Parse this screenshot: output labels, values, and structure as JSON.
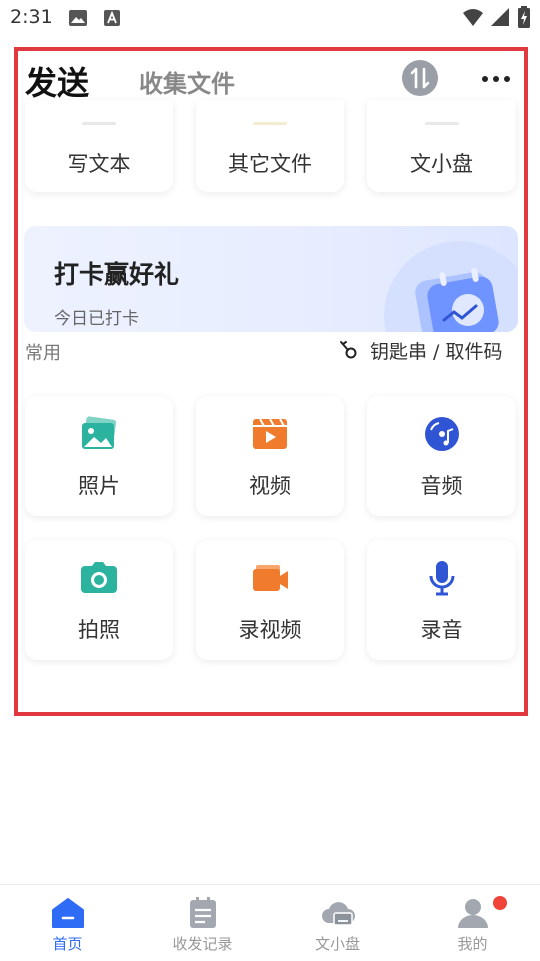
{
  "status_bar": {
    "time": "2:31"
  },
  "header": {
    "tab_send": "发送",
    "tab_collect": "收集文件"
  },
  "top_row": [
    "写文本",
    "其它文件",
    "文小盘"
  ],
  "banner": {
    "title": "打卡赢好礼",
    "subtitle": "今日已打卡"
  },
  "common": {
    "label": "常用",
    "keychain_link": "钥匙串 / 取件码"
  },
  "grid": [
    {
      "label": "照片",
      "icon": "photo-icon"
    },
    {
      "label": "视频",
      "icon": "video-icon"
    },
    {
      "label": "音频",
      "icon": "audio-icon"
    },
    {
      "label": "拍照",
      "icon": "camera-icon"
    },
    {
      "label": "录视频",
      "icon": "video-record-icon"
    },
    {
      "label": "录音",
      "icon": "microphone-icon"
    }
  ],
  "bottom_nav": [
    {
      "label": "首页",
      "icon": "home-icon",
      "active": true
    },
    {
      "label": "收发记录",
      "icon": "records-icon",
      "active": false
    },
    {
      "label": "文小盘",
      "icon": "cloud-drive-icon",
      "active": false
    },
    {
      "label": "我的",
      "icon": "profile-icon",
      "active": false,
      "badge": true
    }
  ],
  "colors": {
    "accent": "#2f6cf5",
    "teal_icon": "#2bb3a0",
    "orange_icon": "#f07b2c",
    "blue_icon": "#2f55d4",
    "highlight_frame": "#e0393f",
    "badge": "#f0443a"
  }
}
